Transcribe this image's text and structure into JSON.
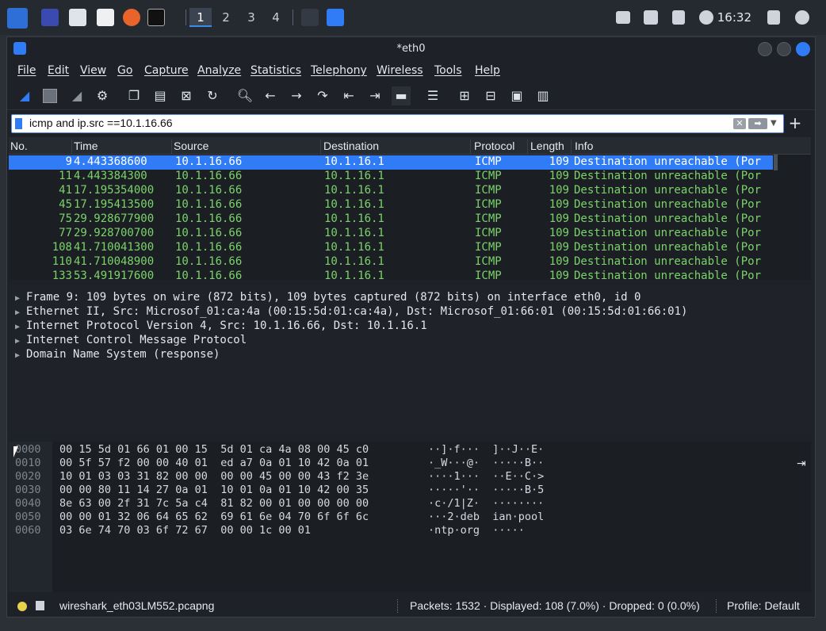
{
  "taskbar": {
    "workspaces": [
      "1",
      "2",
      "3",
      "4"
    ],
    "clock": "16:32"
  },
  "window": {
    "title": "*eth0"
  },
  "menu": [
    "File",
    "Edit",
    "View",
    "Go",
    "Capture",
    "Analyze",
    "Statistics",
    "Telephony",
    "Wireless",
    "Tools",
    "Help"
  ],
  "filter": {
    "value": "icmp and ip.src ==10.1.16.66"
  },
  "packet_list": {
    "columns": [
      "No.",
      "Time",
      "Source",
      "Destination",
      "Protocol",
      "Length",
      "Info"
    ],
    "rows": [
      [
        "9",
        "4.443368600",
        "10.1.16.66",
        "10.1.16.1",
        "ICMP",
        "109",
        "Destination unreachable (Por"
      ],
      [
        "11",
        "4.443384300",
        "10.1.16.66",
        "10.1.16.1",
        "ICMP",
        "109",
        "Destination unreachable (Por"
      ],
      [
        "41",
        "17.195354000",
        "10.1.16.66",
        "10.1.16.1",
        "ICMP",
        "109",
        "Destination unreachable (Por"
      ],
      [
        "45",
        "17.195413500",
        "10.1.16.66",
        "10.1.16.1",
        "ICMP",
        "109",
        "Destination unreachable (Por"
      ],
      [
        "75",
        "29.928677900",
        "10.1.16.66",
        "10.1.16.1",
        "ICMP",
        "109",
        "Destination unreachable (Por"
      ],
      [
        "77",
        "29.928700700",
        "10.1.16.66",
        "10.1.16.1",
        "ICMP",
        "109",
        "Destination unreachable (Por"
      ],
      [
        "108",
        "41.710041300",
        "10.1.16.66",
        "10.1.16.1",
        "ICMP",
        "109",
        "Destination unreachable (Por"
      ],
      [
        "110",
        "41.710048900",
        "10.1.16.66",
        "10.1.16.1",
        "ICMP",
        "109",
        "Destination unreachable (Por"
      ],
      [
        "133",
        "53.491917600",
        "10.1.16.66",
        "10.1.16.1",
        "ICMP",
        "109",
        "Destination unreachable (Por"
      ]
    ]
  },
  "details": [
    "Frame 9: 109 bytes on wire (872 bits), 109 bytes captured (872 bits) on interface eth0, id 0",
    "Ethernet II, Src: Microsof_01:ca:4a (00:15:5d:01:ca:4a), Dst: Microsof_01:66:01 (00:15:5d:01:66:01)",
    "Internet Protocol Version 4, Src: 10.1.16.66, Dst: 10.1.16.1",
    "Internet Control Message Protocol",
    "Domain Name System (response)"
  ],
  "hex": [
    {
      "off": "0000",
      "bytes": "00 15 5d 01 66 01 00 15  5d 01 ca 4a 08 00 45 c0",
      "ascii": "··]·f···  ]··J··E·"
    },
    {
      "off": "0010",
      "bytes": "00 5f 57 f2 00 00 40 01  ed a7 0a 01 10 42 0a 01",
      "ascii": "·_W···@·  ·····B··"
    },
    {
      "off": "0020",
      "bytes": "10 01 03 03 31 82 00 00  00 00 45 00 00 43 f2 3e",
      "ascii": "····1···  ··E··C·>"
    },
    {
      "off": "0030",
      "bytes": "00 00 80 11 14 27 0a 01  10 01 0a 01 10 42 00 35",
      "ascii": "·····'··  ·····B·5"
    },
    {
      "off": "0040",
      "bytes": "8e 63 00 2f 31 7c 5a c4  81 82 00 01 00 00 00 00",
      "ascii": "·c·/1|Z·  ········"
    },
    {
      "off": "0050",
      "bytes": "00 00 01 32 06 64 65 62  69 61 6e 04 70 6f 6f 6c",
      "ascii": "···2·deb  ian·pool"
    },
    {
      "off": "0060",
      "bytes": "03 6e 74 70 03 6f 72 67  00 00 1c 00 01",
      "ascii": "·ntp·org  ·····"
    }
  ],
  "status": {
    "file": "wireshark_eth03LM552.pcapng",
    "packets": "Packets: 1532 · Displayed: 108 (7.0%) · Dropped: 0 (0.0%)",
    "profile": "Profile: Default"
  },
  "colors": {
    "accent": "#2f7cf6",
    "row_text": "#7cd36b",
    "background": "#1b1f24"
  }
}
